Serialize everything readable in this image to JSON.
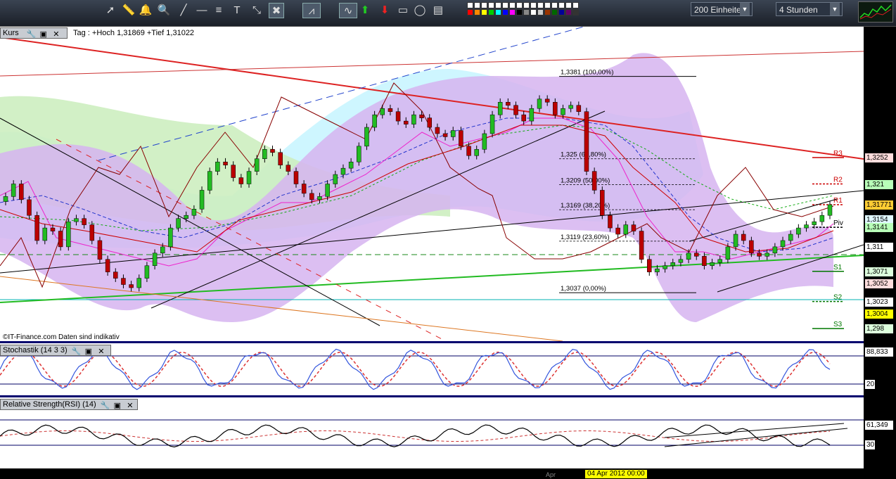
{
  "toolbar": {
    "tools": [
      "cursor-icon",
      "ruler-icon",
      "bell-icon",
      "zoom-icon",
      "trendline-icon",
      "horizontal-line-icon",
      "fibonacci-icon",
      "text-icon",
      "arrows-icon",
      "tools-icon",
      "chart-style-icon",
      "indicator-icon",
      "up-arrow-icon",
      "down-arrow-icon",
      "rectangle-icon",
      "ellipse-icon",
      "text-box-icon"
    ],
    "colors": [
      "#ffffff",
      "#ffffff",
      "#ffffff",
      "#ffffff",
      "#ffffff",
      "#ffffff",
      "#ffffff",
      "#ffffff",
      "#ffffff",
      "#ffffff",
      "#ffffff",
      "#ffffff",
      "#ffffff",
      "#ffffff",
      "#ffffff",
      "#ffffff",
      "#ff0000",
      "#ff8800",
      "#ffff00",
      "#00cc00",
      "#00ffff",
      "#0000ff",
      "#ff00ff",
      "#000000",
      "#888888",
      "#ffffff",
      "#cccccc",
      "#993300",
      "#006600",
      "#000099",
      "#660066",
      "#333333"
    ],
    "bars_select": "200 Einheiten",
    "interval_select": "4 Stunden"
  },
  "price_panel": {
    "title": "Kurs",
    "info": "Tag : +Hoch 1,31869 +Tief 1,31022",
    "copyright": "©IT-Finance.com  Daten sind indikativ"
  },
  "stoch_panel": {
    "title": "Stochastik (14 3 3)"
  },
  "rsi_panel": {
    "title": "Relative Strength(RSI) (14)"
  },
  "x_axis": {
    "highlight": "04 Apr 2012 00:00",
    "month_label": "Apr"
  },
  "chart_data": {
    "type": "candlestick",
    "price_scale_labels": [
      "1,3252",
      "1,321",
      "1,31771",
      "1,3154",
      "1,3141",
      "1,311",
      "1,3071",
      "1,3052",
      "1,3023",
      "1,3004",
      "1,298"
    ],
    "fibonacci": [
      {
        "level": "100,00%",
        "price": "1,3381"
      },
      {
        "level": "61,80%",
        "price": "1,325"
      },
      {
        "level": "50,00%",
        "price": "1,3209"
      },
      {
        "level": "38,20%",
        "price": "1,3169"
      },
      {
        "level": "23,60%",
        "price": "1,3119"
      },
      {
        "level": "0,00%",
        "price": "1,3037"
      }
    ],
    "pivots": [
      {
        "name": "R3",
        "price": 1.3252
      },
      {
        "name": "R2",
        "price": 1.321
      },
      {
        "name": "R1",
        "price": 1.3177
      },
      {
        "name": "Piv",
        "price": 1.3141
      },
      {
        "name": "S1",
        "price": 1.3071
      },
      {
        "name": "S2",
        "price": 1.3023
      },
      {
        "name": "S3",
        "price": 1.298
      }
    ],
    "last_price": "1,31771",
    "ylim": [
      1.296,
      1.346
    ],
    "stochastic": {
      "value": "88,833",
      "levels": [
        "80",
        "20"
      ]
    },
    "rsi": {
      "value": "61,349",
      "levels": [
        "70",
        "30"
      ]
    }
  }
}
